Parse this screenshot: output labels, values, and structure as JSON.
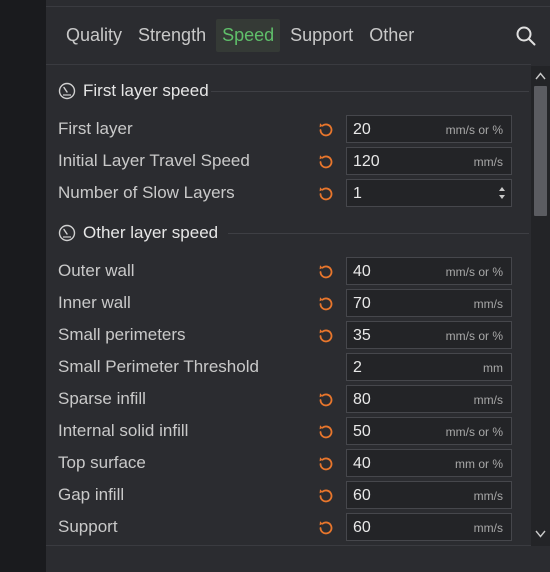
{
  "tabs": [
    {
      "label": "Quality"
    },
    {
      "label": "Strength"
    },
    {
      "label": "Speed"
    },
    {
      "label": "Support"
    },
    {
      "label": "Other"
    }
  ],
  "active_tab": "Speed",
  "accent_color": "#5fbf6a",
  "reset_icon_color": "#e8762c",
  "sections": {
    "first": {
      "title": "First layer speed",
      "rows": [
        {
          "label": "First layer",
          "value": "20",
          "unit": "mm/s or %"
        },
        {
          "label": "Initial Layer Travel Speed",
          "value": "120",
          "unit": "mm/s"
        },
        {
          "label": "Number of Slow Layers",
          "value": "1",
          "unit": ""
        }
      ]
    },
    "other": {
      "title": "Other layer speed",
      "rows": [
        {
          "label": "Outer wall",
          "value": "40",
          "unit": "mm/s or %"
        },
        {
          "label": "Inner wall",
          "value": "70",
          "unit": "mm/s"
        },
        {
          "label": "Small perimeters",
          "value": "35",
          "unit": "mm/s or %"
        },
        {
          "label": "Small Perimeter Threshold",
          "value": "2",
          "unit": "mm"
        },
        {
          "label": "Sparse infill",
          "value": "80",
          "unit": "mm/s"
        },
        {
          "label": "Internal solid infill",
          "value": "50",
          "unit": "mm/s or %"
        },
        {
          "label": "Top surface",
          "value": "40",
          "unit": "mm or %"
        },
        {
          "label": "Gap infill",
          "value": "60",
          "unit": "mm/s"
        },
        {
          "label": "Support",
          "value": "60",
          "unit": "mm/s"
        }
      ]
    }
  },
  "icons": {
    "search": "search-icon",
    "gauge": "gauge-icon",
    "reset": "reset-icon",
    "spinner": "spinner-icon"
  }
}
